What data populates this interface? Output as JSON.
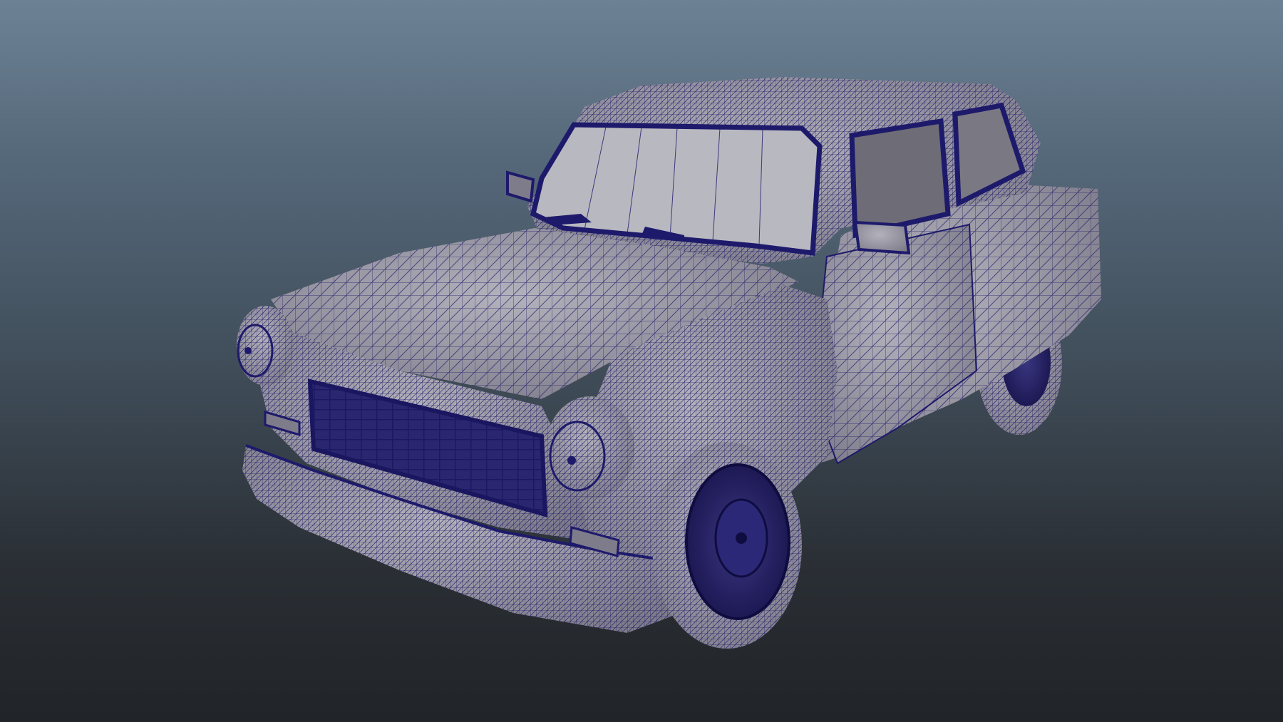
{
  "viewport": {
    "background_top_color": "#6c8294",
    "background_bottom_color": "#212428",
    "background_style": "vertical-gradient"
  },
  "model": {
    "subject": "car",
    "display_mode": "wireframe-on-shaded",
    "surface_color": "#9a98a3",
    "wire_color": "#1e1a6b",
    "glass_color": "#b8b8c0"
  }
}
